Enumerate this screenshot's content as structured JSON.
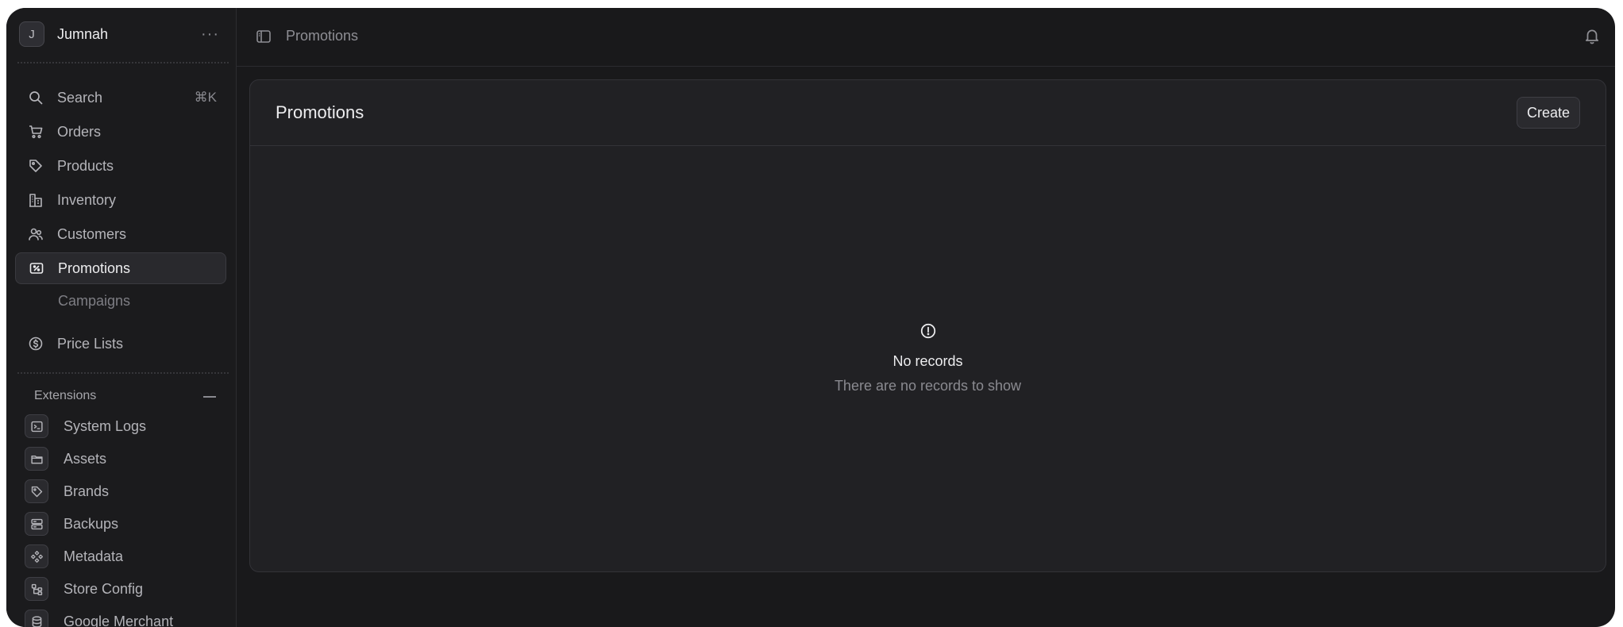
{
  "store": {
    "avatar_letter": "J",
    "name": "Jumnah",
    "menu_glyph": "···"
  },
  "nav": {
    "search": {
      "label": "Search",
      "shortcut": "⌘K",
      "icon": "search-icon"
    },
    "items": [
      {
        "label": "Orders",
        "icon": "cart-icon"
      },
      {
        "label": "Products",
        "icon": "tag-icon"
      },
      {
        "label": "Inventory",
        "icon": "building-icon"
      },
      {
        "label": "Customers",
        "icon": "users-icon"
      },
      {
        "label": "Promotions",
        "icon": "receipt-percent-icon",
        "active": true
      },
      {
        "label": "Price Lists",
        "icon": "currency-dollar-icon"
      }
    ],
    "sub_items": [
      {
        "label": "Campaigns"
      }
    ]
  },
  "extensions": {
    "label": "Extensions",
    "items": [
      {
        "label": "System Logs",
        "icon": "terminal-icon"
      },
      {
        "label": "Assets",
        "icon": "folder-icon"
      },
      {
        "label": "Brands",
        "icon": "tag-icon"
      },
      {
        "label": "Backups",
        "icon": "server-icon"
      },
      {
        "label": "Metadata",
        "icon": "component-icon"
      },
      {
        "label": "Store Config",
        "icon": "tree-icon"
      },
      {
        "label": "Google Merchant",
        "icon": "database-icon"
      }
    ]
  },
  "topbar": {
    "breadcrumb": "Promotions"
  },
  "page": {
    "title": "Promotions",
    "create_label": "Create",
    "empty_title": "No records",
    "empty_subtitle": "There are no records to show"
  },
  "colors": {
    "background": "#19191b",
    "sidebar": "#1b1b1d",
    "card": "#212124",
    "text_primary": "#ededef",
    "text_muted": "#8a8a90"
  }
}
